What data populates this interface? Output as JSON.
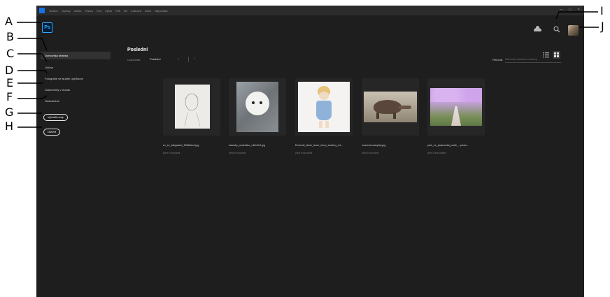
{
  "menubar": {
    "menus": [
      "Soubor",
      "Úpravy",
      "Obraz",
      "Vrstva",
      "Text",
      "Výběr",
      "Filtr",
      "3D",
      "Zobrazit",
      "Okno",
      "Nápověda"
    ],
    "window_controls": [
      "–",
      "□",
      "×"
    ]
  },
  "header": {
    "logo_text": "Ps",
    "cloud_icon": "cloud-icon",
    "search_icon": "search-icon",
    "avatar": "user-avatar"
  },
  "sidebar": {
    "items": [
      {
        "label": "Domovská stránka",
        "active": true
      },
      {
        "label": "Učit se"
      },
      {
        "label": "Fotografie ve službě Lightroom"
      },
      {
        "label": "Dokumenty v cloudu"
      },
      {
        "label": "Odstraněné"
      }
    ],
    "create_new_label": "Vytvořit nový",
    "open_label": "Otevřít"
  },
  "main": {
    "title": "Poslední",
    "sort_label": "Uspořádat",
    "sort_value": "Poslední",
    "sort_chevron": "⌄",
    "sort_direction": "↓",
    "filter_label": "Filtrovat",
    "filter_placeholder": "Filtrovat poslední soubory"
  },
  "files": [
    {
      "name": "ex_ex_sdbgaskel_6968dec4.jpg",
      "time": "před 5 minutami"
    },
    {
      "name": "katowky_sedelakur_c45c4h2.jpg",
      "time": "před 5 minutami"
    },
    {
      "name": "Embroid_blank_lewor_temp_sharkey_int...",
      "time": "před 5 minutami"
    },
    {
      "name": "mravenecnakyzky.jpg",
      "time": "před 5 minutami"
    },
    {
      "name": "park_ve_jacarandai_podle_...photo...",
      "time": "před 5 sekundami"
    }
  ],
  "callouts": {
    "labels": [
      "A",
      "B",
      "C",
      "D",
      "E",
      "F",
      "G",
      "H",
      "I",
      "J"
    ]
  },
  "colors": {
    "app_bg": "#1e1e1e",
    "menubar_bg": "#2b2b2b",
    "ps_blue": "#31a8ff",
    "active_nav": "#323232"
  }
}
